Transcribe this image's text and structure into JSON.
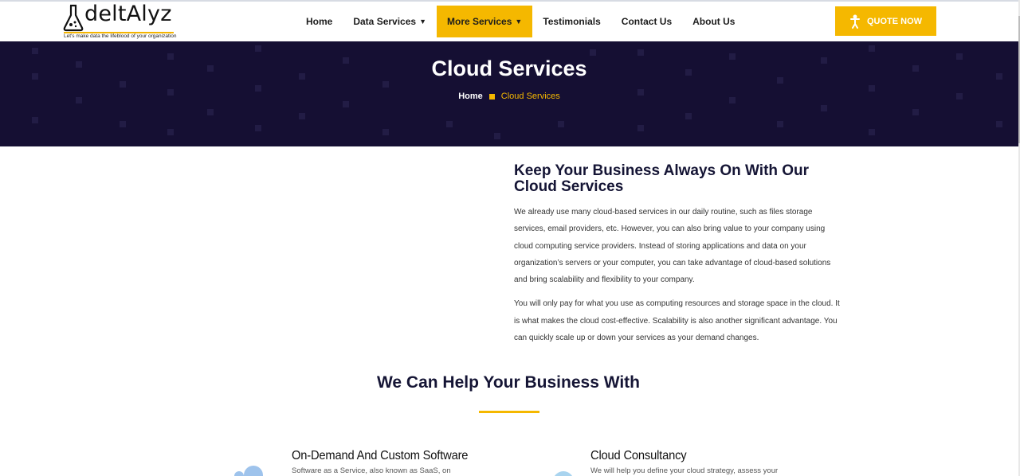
{
  "brand": {
    "name": "deltAlyz",
    "tagline": "Let's make data the lifeblood of your organization",
    "accent_color": "#f5b800",
    "hero_color": "#150f33"
  },
  "nav": {
    "items": [
      {
        "label": "Home"
      },
      {
        "label": "Data Services",
        "has_dropdown": true
      },
      {
        "label": "More Services",
        "has_dropdown": true,
        "active": true
      },
      {
        "label": "Testimonials"
      },
      {
        "label": "Contact Us"
      },
      {
        "label": "About Us"
      }
    ],
    "quote_button": "QUOTE NOW"
  },
  "hero": {
    "title": "Cloud Services",
    "breadcrumb": {
      "home": "Home",
      "current": "Cloud Services"
    }
  },
  "intro": {
    "heading": "Keep Your Business Always On With Our Cloud Services",
    "paragraph1": "We already use many cloud-based services in our daily routine, such as files storage services, email providers, etc. However, you can also bring value to your company using cloud computing service providers. Instead of storing applications and data on your organization’s servers or your computer, you can take advantage of cloud-based solutions and bring scalability and flexibility to your company.",
    "paragraph2": "You will only pay for what you use as computing resources and storage space in the cloud. It is what makes the cloud cost-effective. Scalability is also another significant advantage. You can quickly scale up or down your services as your demand changes."
  },
  "help": {
    "title": "We Can Help Your Business With",
    "services": [
      {
        "title": "On-Demand And Custom Software",
        "desc": "Software as a Service, also known as SaaS, on",
        "icon": "cloud-icon"
      },
      {
        "title": "Cloud Consultancy",
        "desc": "We will help you define your cloud strategy, assess your",
        "icon": "consultancy-icon"
      }
    ]
  }
}
